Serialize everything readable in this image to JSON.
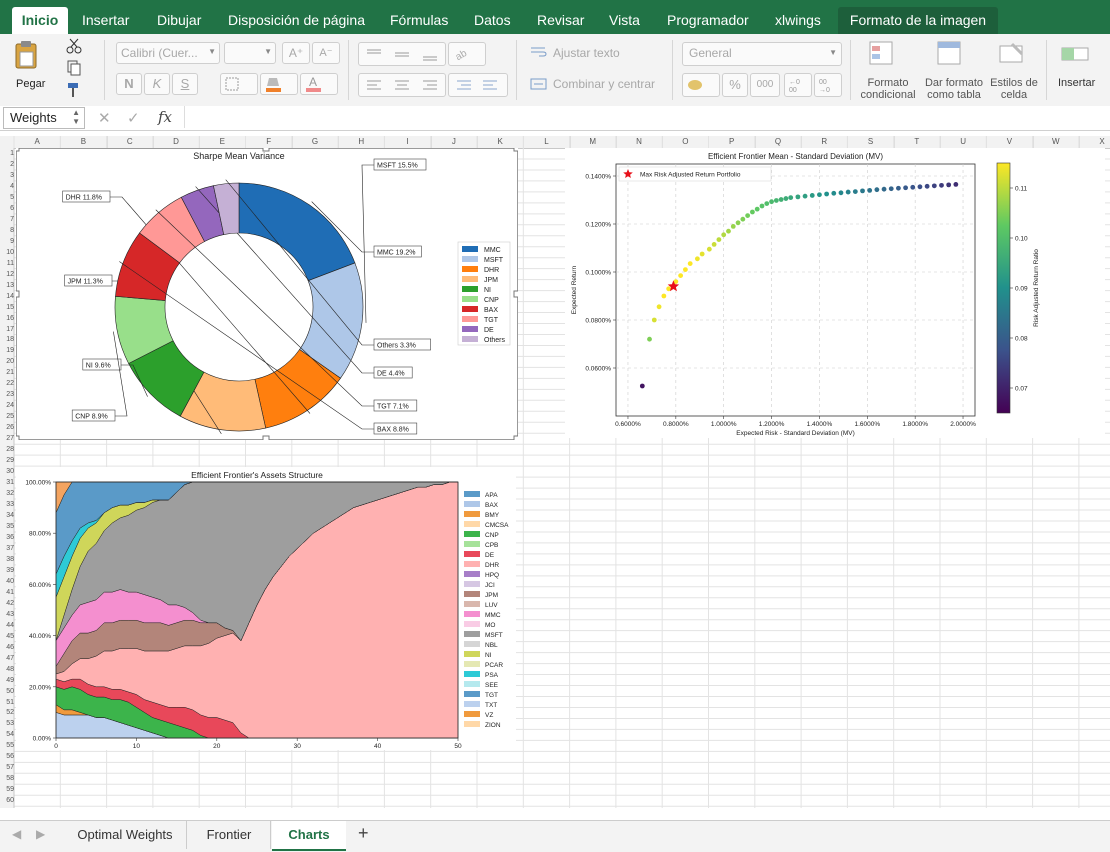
{
  "ribbon": {
    "tabs": [
      "Inicio",
      "Insertar",
      "Dibujar",
      "Disposición de página",
      "Fórmulas",
      "Datos",
      "Revisar",
      "Vista",
      "Programador",
      "xlwings"
    ],
    "context_tab": "Formato de la imagen"
  },
  "toolbar": {
    "paste_label": "Pegar",
    "font_name": "Calibri (Cuer...",
    "bold": "N",
    "italic": "K",
    "underline": "S",
    "wrap_text": "Ajustar texto",
    "merge_center": "Combinar y centrar",
    "number_format": "General",
    "percent": "%",
    "thousands": "000",
    "cond_format": "Formato condicional",
    "format_table": "Dar formato como tabla",
    "cell_styles": "Estilos de celda",
    "insert": "Insertar"
  },
  "formula_bar": {
    "name_box": "Weights",
    "fx": "fx"
  },
  "sheet": {
    "columns": [
      "A",
      "B",
      "C",
      "D",
      "E",
      "F",
      "G",
      "H",
      "I",
      "J",
      "K",
      "L",
      "M",
      "N",
      "O",
      "P",
      "Q",
      "R",
      "S",
      "T",
      "U",
      "V",
      "W",
      "X"
    ],
    "rows": [
      "1",
      "2",
      "3",
      "4",
      "5",
      "6",
      "7",
      "8",
      "9",
      "10",
      "11",
      "12",
      "13",
      "14",
      "15",
      "16",
      "17",
      "18",
      "19",
      "20",
      "21",
      "22",
      "23",
      "24",
      "25",
      "26",
      "27",
      "28",
      "29",
      "30",
      "31",
      "32",
      "33",
      "34",
      "35",
      "36",
      "37",
      "38",
      "39",
      "40",
      "41",
      "42",
      "43",
      "44",
      "45",
      "46",
      "47",
      "48",
      "49",
      "50",
      "51",
      "52",
      "53",
      "54",
      "55",
      "56",
      "57",
      "58",
      "59",
      "60"
    ]
  },
  "sheet_tabs": [
    "Optimal Weights",
    "Frontier",
    "Charts"
  ],
  "chart_data": [
    {
      "type": "pie",
      "title": "Sharpe Mean Variance",
      "categories": [
        "MMC",
        "MSFT",
        "DHR",
        "JPM",
        "NI",
        "CNP",
        "BAX",
        "TGT",
        "DE",
        "Others"
      ],
      "values": [
        19.2,
        15.5,
        11.8,
        11.3,
        9.6,
        8.9,
        8.8,
        7.1,
        4.4,
        3.3
      ],
      "labels": [
        "MMC 19.2%",
        "MSFT 15.5%",
        "DHR 11.8%",
        "JPM 11.3%",
        "NI 9.6%",
        "CNP 8.9%",
        "BAX 8.8%",
        "TGT 7.1%",
        "DE 4.4%",
        "Others 3.3%"
      ],
      "colors": [
        "#1f6db5",
        "#aec7e8",
        "#ff7f0e",
        "#ffbb78",
        "#2ca02c",
        "#98df8a",
        "#d62728",
        "#ff9896",
        "#9467bd",
        "#c5b0d5"
      ],
      "legend": "right"
    },
    {
      "type": "scatter",
      "title": "Efficient Frontier Mean - Standard Deviation (MV)",
      "xlabel": "Expected Risk - Standard Deviation (MV)",
      "ylabel": "Expected Return",
      "colorbar_label": "Risk Adjusted Return Ratio",
      "xlim": [
        0.55,
        2.05
      ],
      "ylim": [
        0.04,
        0.145
      ],
      "xticks": [
        "0.6000%",
        "0.8000%",
        "1.0000%",
        "1.2000%",
        "1.4000%",
        "1.6000%",
        "1.8000%",
        "2.0000%"
      ],
      "yticks": [
        "0.0600%",
        "0.0800%",
        "0.1000%",
        "0.1200%",
        "0.1400%"
      ],
      "cbar_ticks": [
        "0.07",
        "0.08",
        "0.09",
        "0.10",
        "0.11"
      ],
      "cbar_range": [
        0.065,
        0.115
      ],
      "x": [
        0.66,
        0.69,
        0.71,
        0.73,
        0.75,
        0.77,
        0.8,
        0.82,
        0.84,
        0.86,
        0.89,
        0.91,
        0.94,
        0.96,
        0.98,
        1.0,
        1.02,
        1.04,
        1.06,
        1.08,
        1.1,
        1.12,
        1.14,
        1.16,
        1.18,
        1.2,
        1.22,
        1.24,
        1.26,
        1.28,
        1.31,
        1.34,
        1.37,
        1.4,
        1.43,
        1.46,
        1.49,
        1.52,
        1.55,
        1.58,
        1.61,
        1.64,
        1.67,
        1.7,
        1.73,
        1.76,
        1.79,
        1.82,
        1.85,
        1.88,
        1.91,
        1.94,
        1.97
      ],
      "y": [
        0.0525,
        0.072,
        0.08,
        0.0855,
        0.09,
        0.093,
        0.096,
        0.0985,
        0.101,
        0.1035,
        0.1055,
        0.1075,
        0.1095,
        0.1115,
        0.1135,
        0.1155,
        0.117,
        0.119,
        0.1205,
        0.122,
        0.1235,
        0.125,
        0.1262,
        0.1275,
        0.1285,
        0.1293,
        0.1298,
        0.1302,
        0.1306,
        0.131,
        0.1313,
        0.1316,
        0.1319,
        0.1322,
        0.1325,
        0.1328,
        0.133,
        0.1333,
        0.1335,
        0.1338,
        0.134,
        0.1343,
        0.1345,
        0.1347,
        0.1349,
        0.1351,
        0.1353,
        0.1355,
        0.1357,
        0.1359,
        0.1361,
        0.1363,
        0.1365
      ],
      "ratio": [
        0.068,
        0.105,
        0.112,
        0.114,
        0.115,
        0.116,
        0.116,
        0.116,
        0.116,
        0.115,
        0.114,
        0.113,
        0.112,
        0.111,
        0.11,
        0.109,
        0.108,
        0.107,
        0.106,
        0.105,
        0.104,
        0.103,
        0.102,
        0.101,
        0.1,
        0.099,
        0.098,
        0.097,
        0.096,
        0.095,
        0.094,
        0.093,
        0.092,
        0.091,
        0.09,
        0.089,
        0.088,
        0.087,
        0.086,
        0.085,
        0.084,
        0.083,
        0.082,
        0.081,
        0.08,
        0.079,
        0.078,
        0.077,
        0.076,
        0.075,
        0.074,
        0.073,
        0.072
      ],
      "highlight": {
        "name": "Max Risk Adjusted Return Portfolio",
        "x": 0.79,
        "y": 0.094
      },
      "grid": true,
      "legend": "top-left"
    },
    {
      "type": "area",
      "title": "Efficient Frontier's Assets Structure",
      "xlim": [
        0,
        50
      ],
      "ylim": [
        0,
        100
      ],
      "xticks": [
        "0",
        "10",
        "20",
        "30",
        "40",
        "50"
      ],
      "yticks": [
        "0.00%",
        "20.00%",
        "40.00%",
        "60.00%",
        "80.00%",
        "100.00%"
      ],
      "x": [
        0,
        1,
        2,
        3,
        4,
        5,
        6,
        7,
        8,
        9,
        10,
        11,
        12,
        13,
        14,
        15,
        16,
        17,
        18,
        19,
        20,
        21,
        22,
        23,
        24,
        25,
        26,
        27,
        28,
        29,
        30,
        31,
        32,
        33,
        34,
        35,
        36,
        37,
        38,
        39,
        40,
        41,
        42,
        43,
        44,
        45,
        46,
        47,
        48,
        49,
        50
      ],
      "series": [
        {
          "name": "TXT",
          "color": "#bcd1ee",
          "values": [
            10,
            9,
            9,
            9,
            9,
            8,
            8,
            7,
            6,
            5,
            4,
            3,
            2,
            1,
            0,
            0,
            0,
            0,
            0,
            0,
            0,
            0,
            0,
            0,
            0,
            0,
            0,
            0,
            0,
            0,
            0,
            0,
            0,
            0,
            0,
            0,
            0,
            0,
            0,
            0,
            0,
            0,
            0,
            0,
            0,
            0,
            0,
            0,
            0,
            0,
            0
          ]
        },
        {
          "name": "VZ",
          "color": "#f09a3d",
          "values": [
            3,
            2,
            2,
            1,
            0,
            0,
            0,
            0,
            0,
            0,
            0,
            0,
            0,
            0,
            0,
            0,
            0,
            0,
            0,
            0,
            0,
            0,
            0,
            0,
            0,
            0,
            0,
            0,
            0,
            0,
            0,
            0,
            0,
            0,
            0,
            0,
            0,
            0,
            0,
            0,
            0,
            0,
            0,
            0,
            0,
            0,
            0,
            0,
            0,
            0,
            0
          ]
        },
        {
          "name": "CNP",
          "color": "#3cb44b",
          "values": [
            7,
            8,
            9,
            9,
            8,
            8,
            8,
            8,
            9,
            9,
            8,
            7,
            6,
            6,
            6,
            5,
            4,
            3,
            1,
            0,
            0,
            0,
            0,
            0,
            0,
            0,
            0,
            0,
            0,
            0,
            0,
            0,
            0,
            0,
            0,
            0,
            0,
            0,
            0,
            0,
            0,
            0,
            0,
            0,
            0,
            0,
            0,
            0,
            0,
            0,
            0
          ]
        },
        {
          "name": "DE",
          "color": "#e8485a",
          "values": [
            3,
            3,
            3,
            4,
            4,
            4,
            4,
            4,
            4,
            4,
            5,
            5,
            6,
            6,
            6,
            7,
            8,
            8,
            8,
            8,
            8,
            7,
            6,
            2,
            0,
            0,
            0,
            0,
            0,
            0,
            0,
            0,
            0,
            0,
            0,
            0,
            0,
            0,
            0,
            0,
            0,
            0,
            0,
            0,
            0,
            0,
            0,
            0,
            0,
            0,
            0
          ]
        },
        {
          "name": "DHR",
          "color": "#ffb1b1",
          "values": [
            2,
            4,
            6,
            8,
            10,
            12,
            14,
            15,
            16,
            17,
            18,
            19,
            20,
            21,
            22,
            23,
            24,
            25,
            27,
            29,
            31,
            33,
            35,
            36,
            45,
            52,
            58,
            63,
            67,
            71,
            74,
            77,
            80,
            82,
            84,
            86,
            88,
            90,
            91,
            92,
            93,
            94,
            95,
            96,
            97,
            98,
            98,
            99,
            99,
            100,
            100
          ]
        },
        {
          "name": "LUV",
          "color": "#b3857a",
          "values": [
            3,
            7,
            9,
            10,
            10,
            10,
            11,
            11,
            11,
            11,
            11,
            11,
            11,
            11,
            10,
            10,
            10,
            10,
            9,
            8,
            6,
            3,
            1,
            0,
            0,
            0,
            0,
            0,
            0,
            0,
            0,
            0,
            0,
            0,
            0,
            0,
            0,
            0,
            0,
            0,
            0,
            0,
            0,
            0,
            0,
            0,
            0,
            0,
            0,
            0,
            0
          ]
        },
        {
          "name": "MMC",
          "color": "#f48fcf",
          "values": [
            10,
            10,
            10,
            11,
            12,
            12,
            12,
            12,
            12,
            11,
            11,
            11,
            10,
            9,
            8,
            7,
            5,
            3,
            1,
            0,
            0,
            0,
            0,
            0,
            0,
            0,
            0,
            0,
            0,
            0,
            0,
            0,
            0,
            0,
            0,
            0,
            0,
            0,
            0,
            0,
            0,
            0,
            0,
            0,
            0,
            0,
            0,
            0,
            0,
            0,
            0
          ]
        },
        {
          "name": "MSFT",
          "color": "#9e9e9e",
          "values": [
            0,
            5,
            10,
            15,
            20,
            22,
            24,
            27,
            28,
            30,
            32,
            34,
            37,
            39,
            41,
            44,
            48,
            51,
            54,
            57,
            59,
            61,
            62,
            62,
            55,
            48,
            42,
            37,
            33,
            29,
            26,
            23,
            20,
            18,
            16,
            14,
            12,
            10,
            9,
            8,
            7,
            6,
            5,
            4,
            3,
            2,
            2,
            1,
            1,
            0,
            0
          ]
        },
        {
          "name": "NI",
          "color": "#cfd65a",
          "values": [
            17,
            15,
            13,
            11,
            9,
            8,
            7,
            6,
            5,
            4,
            3,
            2,
            1,
            0,
            0,
            0,
            0,
            0,
            0,
            0,
            0,
            0,
            0,
            0,
            0,
            0,
            0,
            0,
            0,
            0,
            0,
            0,
            0,
            0,
            0,
            0,
            0,
            0,
            0,
            0,
            0,
            0,
            0,
            0,
            0,
            0,
            0,
            0,
            0,
            0,
            0
          ]
        },
        {
          "name": "PSA",
          "color": "#2ecad6",
          "values": [
            9,
            8,
            6,
            4,
            2,
            1,
            0,
            0,
            0,
            0,
            0,
            0,
            0,
            0,
            0,
            0,
            0,
            0,
            0,
            0,
            0,
            0,
            0,
            0,
            0,
            0,
            0,
            0,
            0,
            0,
            0,
            0,
            0,
            0,
            0,
            0,
            0,
            0,
            0,
            0,
            0,
            0,
            0,
            0,
            0,
            0,
            0,
            0,
            0,
            0,
            0
          ]
        },
        {
          "name": "TGT",
          "color": "#5a9ac8",
          "values": [
            24,
            24,
            24,
            23,
            22,
            21,
            20,
            17,
            15,
            14,
            13,
            13,
            12,
            12,
            11,
            10,
            9,
            8,
            7,
            6,
            5,
            4,
            3,
            2,
            1,
            0,
            0,
            0,
            0,
            0,
            0,
            0,
            0,
            0,
            0,
            0,
            0,
            0,
            0,
            0,
            0,
            0,
            0,
            0,
            0,
            0,
            0,
            0,
            0,
            0,
            0
          ]
        },
        {
          "name": "BMY",
          "color": "#f4a460",
          "values": [
            12,
            9,
            8,
            5,
            4,
            3,
            2,
            2,
            2,
            1,
            1,
            1,
            1,
            1,
            1,
            1,
            1,
            0,
            0,
            0,
            0,
            0,
            0,
            0,
            0,
            0,
            0,
            0,
            0,
            0,
            0,
            0,
            0,
            0,
            0,
            0,
            0,
            0,
            0,
            0,
            0,
            0,
            0,
            0,
            0,
            0,
            0,
            0,
            0,
            0,
            0
          ]
        }
      ],
      "legend": [
        "APA",
        "BAX",
        "BMY",
        "CMCSA",
        "CNP",
        "CPB",
        "DE",
        "DHR",
        "HPQ",
        "JCI",
        "JPM",
        "LUV",
        "MMC",
        "MO",
        "MSFT",
        "NBL",
        "NI",
        "PCAR",
        "PSA",
        "SEE",
        "TGT",
        "TXT",
        "VZ",
        "ZION"
      ],
      "legend_colors": [
        "#5a9ac8",
        "#aec7e8",
        "#f09a3d",
        "#ffd8a8",
        "#3cb44b",
        "#a6e29a",
        "#e8485a",
        "#ffb1b1",
        "#a77ec8",
        "#d6c7e3",
        "#b3857a",
        "#d9b7ad",
        "#f48fcf",
        "#f9cce5",
        "#9e9e9e",
        "#d5d5d5",
        "#cfd65a",
        "#e5e8b3",
        "#2ecad6",
        "#b5e9ee",
        "#5a9ac8",
        "#bcd1ee",
        "#f09a3d",
        "#ffd8a8"
      ]
    }
  ]
}
